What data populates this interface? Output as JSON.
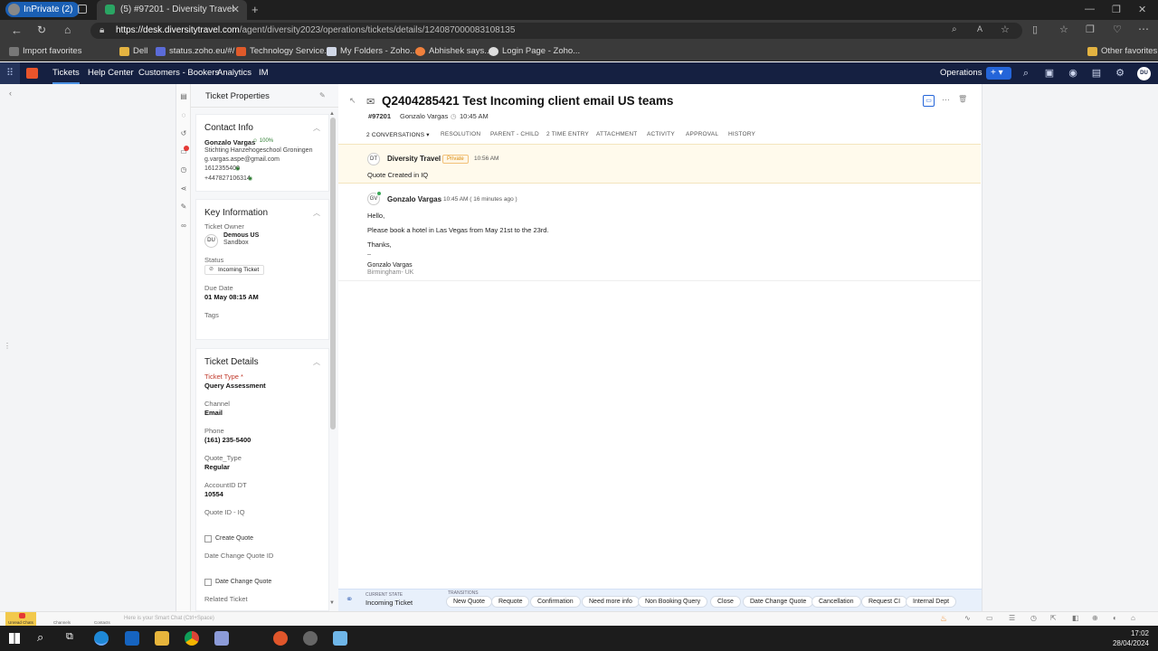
{
  "browser": {
    "inprivate_label": "InPrivate (2)",
    "tab_title": "(5) #97201 - Diversity Travel",
    "url_host": "https://desk.diversitytravel.com",
    "url_path": "/agent/diversity2023/operations/tickets/details/124087000083108135",
    "favorites": [
      "Import favorites",
      "Dell",
      "status.zoho.eu/#/",
      "Technology Service...",
      "My Folders - Zoho...",
      "Abhishek says...",
      "Login Page - Zoho..."
    ],
    "other_favorites": "Other favorites"
  },
  "app_nav": {
    "items": [
      "Tickets",
      "Help Center",
      "Customers - Bookers",
      "Analytics",
      "IM"
    ],
    "department": "Operations",
    "user_initials": "DU"
  },
  "properties": {
    "title": "Ticket Properties",
    "contact": {
      "header": "Contact Info",
      "name": "Gonzalo Vargas",
      "score": "100%",
      "org": "Stichting Hanzehogeschool Groningen",
      "email": "g.vargas.aspe@gmail.com",
      "phone1": "1612355400",
      "phone2": "+447827106314"
    },
    "key_info": {
      "header": "Key Information",
      "owner_label": "Ticket Owner",
      "owner_name": "Demous US",
      "owner_team": "Sandbox",
      "owner_initials": "DU",
      "status_label": "Status",
      "status_value": "Incoming Ticket",
      "due_label": "Due Date",
      "due_value": "01 May 08:15 AM",
      "tags_label": "Tags"
    },
    "details": {
      "header": "Ticket Details",
      "type_label": "Ticket Type *",
      "type_value": "Query Assessment",
      "channel_label": "Channel",
      "channel_value": "Email",
      "phone_label": "Phone",
      "phone_value": "(161) 235-5400",
      "quote_type_label": "Quote_Type",
      "quote_type_value": "Regular",
      "account_label": "AccountID DT",
      "account_value": "10554",
      "quote_id_label": "Quote ID - IQ",
      "create_quote": "Create Quote",
      "date_change_label": "Date Change Quote ID",
      "date_change_quote": "Date Change Quote",
      "related_label": "Related Ticket"
    }
  },
  "ticket": {
    "title": "Q2404285421 Test Incoming client email US teams",
    "number": "#97201",
    "contact": "Gonzalo Vargas",
    "time": "10:45 AM",
    "tabs": [
      "2 CONVERSATIONS",
      "RESOLUTION",
      "PARENT - CHILD",
      "2 TIME ENTRY",
      "ATTACHMENT",
      "ACTIVITY",
      "APPROVAL",
      "HISTORY"
    ]
  },
  "private_note": {
    "initials": "DT",
    "author": "Diversity Travel",
    "badge": "Private",
    "time": "10:56 AM",
    "text": "Quote Created in IQ"
  },
  "message": {
    "initials": "GV",
    "author": "Gonzalo Vargas",
    "time": "10:45 AM ( 16 minutes ago )",
    "lines": [
      "Hello,",
      "Please book a hotel in Las Vegas from May 21st to the 23rd.",
      "Thanks,"
    ],
    "sig_sep": "--",
    "sig_name": "Gonzalo Vargas",
    "sig_loc": "Birmingham- UK"
  },
  "state": {
    "current_label": "CURRENT STATE",
    "current_value": "Incoming Ticket",
    "transitions_label": "TRANSITIONS",
    "transitions": [
      "New Quote",
      "Requote",
      "Confirmation",
      "Need more info",
      "Non Booking Query",
      "Close",
      "Date Change Quote",
      "Cancellation",
      "Request CI",
      "Internal Dept"
    ]
  },
  "smart_chat": {
    "items": [
      "Unread Chats",
      "Channels",
      "Contacts"
    ],
    "placeholder": "Here is your Smart Chat (Ctrl+Space)"
  },
  "taskbar": {
    "time": "17:02",
    "date": "28/04/2024"
  },
  "colors": {
    "nav_bg": "#152041",
    "accent": "#2465d9",
    "private_bg": "#fffaec",
    "required": "#c0392b"
  }
}
